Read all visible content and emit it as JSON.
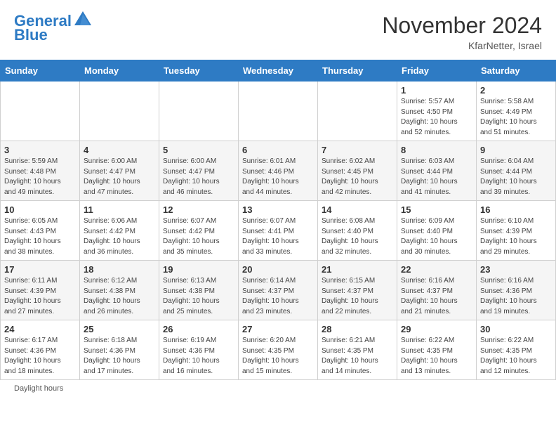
{
  "header": {
    "logo_text_general": "General",
    "logo_text_blue": "Blue",
    "month_title": "November 2024",
    "location": "KfarNetter, Israel"
  },
  "calendar": {
    "weekdays": [
      "Sunday",
      "Monday",
      "Tuesday",
      "Wednesday",
      "Thursday",
      "Friday",
      "Saturday"
    ],
    "weeks": [
      [
        {
          "day": "",
          "info": ""
        },
        {
          "day": "",
          "info": ""
        },
        {
          "day": "",
          "info": ""
        },
        {
          "day": "",
          "info": ""
        },
        {
          "day": "",
          "info": ""
        },
        {
          "day": "1",
          "info": "Sunrise: 5:57 AM\nSunset: 4:50 PM\nDaylight: 10 hours\nand 52 minutes."
        },
        {
          "day": "2",
          "info": "Sunrise: 5:58 AM\nSunset: 4:49 PM\nDaylight: 10 hours\nand 51 minutes."
        }
      ],
      [
        {
          "day": "3",
          "info": "Sunrise: 5:59 AM\nSunset: 4:48 PM\nDaylight: 10 hours\nand 49 minutes."
        },
        {
          "day": "4",
          "info": "Sunrise: 6:00 AM\nSunset: 4:47 PM\nDaylight: 10 hours\nand 47 minutes."
        },
        {
          "day": "5",
          "info": "Sunrise: 6:00 AM\nSunset: 4:47 PM\nDaylight: 10 hours\nand 46 minutes."
        },
        {
          "day": "6",
          "info": "Sunrise: 6:01 AM\nSunset: 4:46 PM\nDaylight: 10 hours\nand 44 minutes."
        },
        {
          "day": "7",
          "info": "Sunrise: 6:02 AM\nSunset: 4:45 PM\nDaylight: 10 hours\nand 42 minutes."
        },
        {
          "day": "8",
          "info": "Sunrise: 6:03 AM\nSunset: 4:44 PM\nDaylight: 10 hours\nand 41 minutes."
        },
        {
          "day": "9",
          "info": "Sunrise: 6:04 AM\nSunset: 4:44 PM\nDaylight: 10 hours\nand 39 minutes."
        }
      ],
      [
        {
          "day": "10",
          "info": "Sunrise: 6:05 AM\nSunset: 4:43 PM\nDaylight: 10 hours\nand 38 minutes."
        },
        {
          "day": "11",
          "info": "Sunrise: 6:06 AM\nSunset: 4:42 PM\nDaylight: 10 hours\nand 36 minutes."
        },
        {
          "day": "12",
          "info": "Sunrise: 6:07 AM\nSunset: 4:42 PM\nDaylight: 10 hours\nand 35 minutes."
        },
        {
          "day": "13",
          "info": "Sunrise: 6:07 AM\nSunset: 4:41 PM\nDaylight: 10 hours\nand 33 minutes."
        },
        {
          "day": "14",
          "info": "Sunrise: 6:08 AM\nSunset: 4:40 PM\nDaylight: 10 hours\nand 32 minutes."
        },
        {
          "day": "15",
          "info": "Sunrise: 6:09 AM\nSunset: 4:40 PM\nDaylight: 10 hours\nand 30 minutes."
        },
        {
          "day": "16",
          "info": "Sunrise: 6:10 AM\nSunset: 4:39 PM\nDaylight: 10 hours\nand 29 minutes."
        }
      ],
      [
        {
          "day": "17",
          "info": "Sunrise: 6:11 AM\nSunset: 4:39 PM\nDaylight: 10 hours\nand 27 minutes."
        },
        {
          "day": "18",
          "info": "Sunrise: 6:12 AM\nSunset: 4:38 PM\nDaylight: 10 hours\nand 26 minutes."
        },
        {
          "day": "19",
          "info": "Sunrise: 6:13 AM\nSunset: 4:38 PM\nDaylight: 10 hours\nand 25 minutes."
        },
        {
          "day": "20",
          "info": "Sunrise: 6:14 AM\nSunset: 4:37 PM\nDaylight: 10 hours\nand 23 minutes."
        },
        {
          "day": "21",
          "info": "Sunrise: 6:15 AM\nSunset: 4:37 PM\nDaylight: 10 hours\nand 22 minutes."
        },
        {
          "day": "22",
          "info": "Sunrise: 6:16 AM\nSunset: 4:37 PM\nDaylight: 10 hours\nand 21 minutes."
        },
        {
          "day": "23",
          "info": "Sunrise: 6:16 AM\nSunset: 4:36 PM\nDaylight: 10 hours\nand 19 minutes."
        }
      ],
      [
        {
          "day": "24",
          "info": "Sunrise: 6:17 AM\nSunset: 4:36 PM\nDaylight: 10 hours\nand 18 minutes."
        },
        {
          "day": "25",
          "info": "Sunrise: 6:18 AM\nSunset: 4:36 PM\nDaylight: 10 hours\nand 17 minutes."
        },
        {
          "day": "26",
          "info": "Sunrise: 6:19 AM\nSunset: 4:36 PM\nDaylight: 10 hours\nand 16 minutes."
        },
        {
          "day": "27",
          "info": "Sunrise: 6:20 AM\nSunset: 4:35 PM\nDaylight: 10 hours\nand 15 minutes."
        },
        {
          "day": "28",
          "info": "Sunrise: 6:21 AM\nSunset: 4:35 PM\nDaylight: 10 hours\nand 14 minutes."
        },
        {
          "day": "29",
          "info": "Sunrise: 6:22 AM\nSunset: 4:35 PM\nDaylight: 10 hours\nand 13 minutes."
        },
        {
          "day": "30",
          "info": "Sunrise: 6:22 AM\nSunset: 4:35 PM\nDaylight: 10 hours\nand 12 minutes."
        }
      ]
    ]
  },
  "footer": {
    "daylight_label": "Daylight hours"
  },
  "colors": {
    "header_bg": "#2e7bc4",
    "accent": "#2e7bc4"
  }
}
